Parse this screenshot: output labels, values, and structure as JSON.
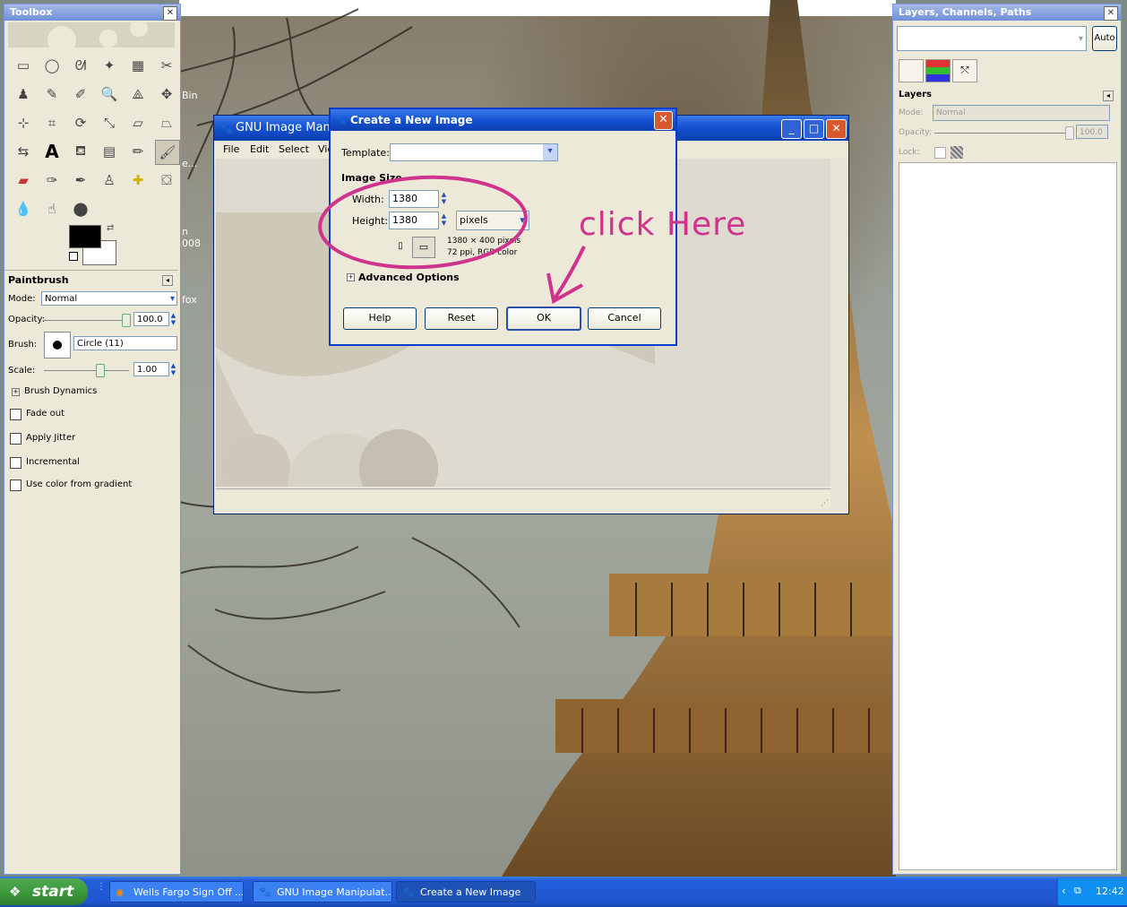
{
  "toolbox": {
    "title": "Toolbox",
    "tool_options_title": "Paintbrush",
    "mode_label": "Mode:",
    "mode_value": "Normal",
    "opacity_label": "Opacity:",
    "opacity_value": "100.0",
    "brush_label": "Brush:",
    "brush_value": "Circle (11)",
    "scale_label": "Scale:",
    "scale_value": "1.00",
    "brush_dynamics": "Brush Dynamics",
    "fade_out": "Fade out",
    "apply_jitter": "Apply Jitter",
    "incremental": "Incremental",
    "use_color_gradient": "Use color from gradient"
  },
  "gimp_window": {
    "title": "GNU Image Manipu",
    "menus": [
      "File",
      "Edit",
      "Select",
      "Vie"
    ]
  },
  "dialog": {
    "title": "Create a New Image",
    "template_label": "Template:",
    "template_value": "",
    "image_size_label": "Image Size",
    "width_label": "Width:",
    "width_value": "1380",
    "height_label": "Height:",
    "height_value": "1380",
    "unit_value": "pixels",
    "info_line1": "1380 × 400 pixels",
    "info_line2": "72 ppi, RGB color",
    "advanced": "Advanced Options",
    "buttons": {
      "help": "Help",
      "reset": "Reset",
      "ok": "OK",
      "cancel": "Cancel"
    }
  },
  "annotation": {
    "text": "click Here"
  },
  "desktop_snippets": [
    "Bin",
    "e...",
    "n",
    "008",
    "fox"
  ],
  "layers": {
    "title": "Layers, Channels, Paths",
    "auto_button": "Auto",
    "section_title": "Layers",
    "mode_label": "Mode:",
    "mode_value": "Normal",
    "opacity_label": "Opacity:",
    "opacity_value": "100.0",
    "lock_label": "Lock:"
  },
  "taskbar": {
    "start": "start",
    "tasks": [
      "Wells Fargo Sign Off ...",
      "GNU Image Manipulat...",
      "Create a New Image"
    ],
    "time": "12:42"
  }
}
